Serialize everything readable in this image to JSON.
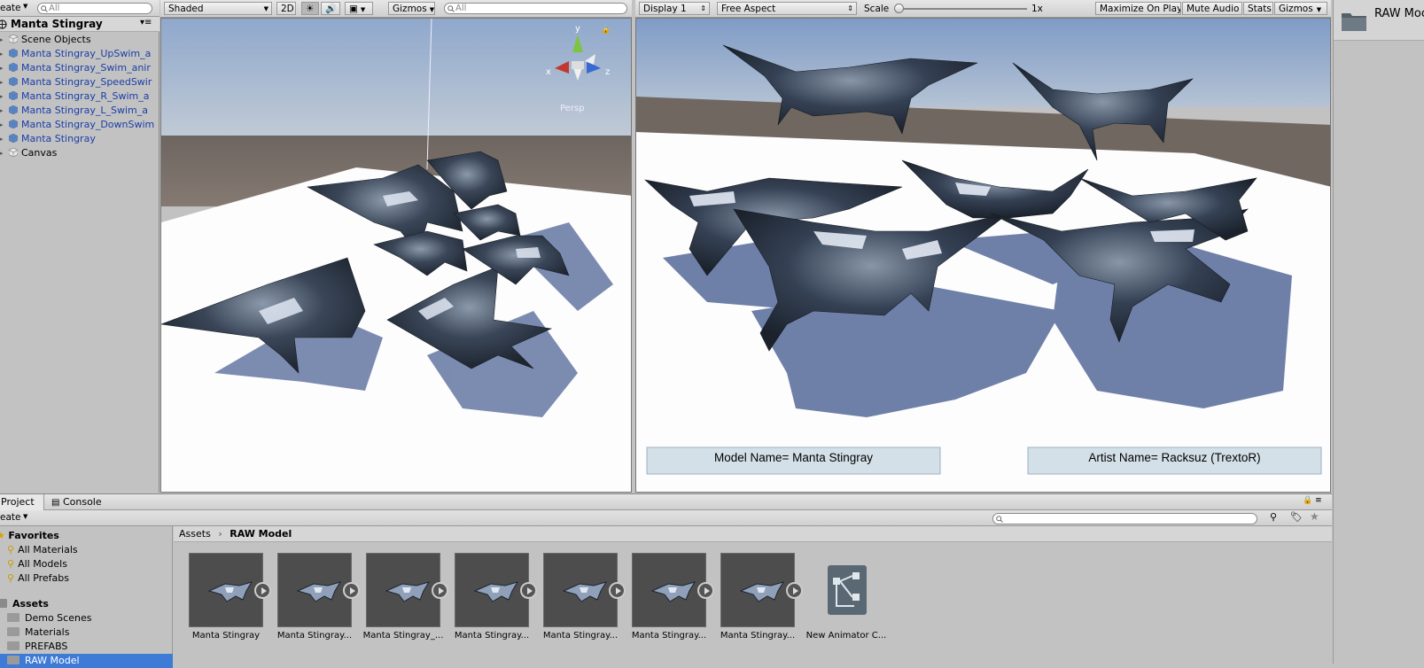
{
  "hierarchy": {
    "create_label": "eate",
    "search_placeholder": "All",
    "scene_title": "Manta Stingray",
    "items": [
      {
        "label": "Scene Objects",
        "linked": false
      },
      {
        "label": "Manta Stingray_UpSwim_a",
        "linked": true
      },
      {
        "label": "Manta Stingray_Swim_anir",
        "linked": true
      },
      {
        "label": "Manta Stingray_SpeedSwir",
        "linked": true
      },
      {
        "label": "Manta Stingray_R_Swim_a",
        "linked": true
      },
      {
        "label": "Manta Stingray_L_Swim_a",
        "linked": true
      },
      {
        "label": "Manta Stingray_DownSwim",
        "linked": true
      },
      {
        "label": "Manta Stingray",
        "linked": true
      },
      {
        "label": "Canvas",
        "linked": false
      }
    ]
  },
  "scene_view": {
    "shading_mode": "Shaded",
    "mode_2d": "2D",
    "gizmos_label": "Gizmos",
    "search_placeholder": "All",
    "gizmo": {
      "y": "y",
      "x": "x",
      "z": "z",
      "persp": "Persp"
    }
  },
  "game_view": {
    "display": "Display 1",
    "aspect": "Free Aspect",
    "scale_label": "Scale",
    "scale_value": "1x",
    "scale_fraction": 0.0,
    "maximize_on_play": "Maximize On Play",
    "mute_audio": "Mute Audio",
    "stats": "Stats",
    "gizmos": "Gizmos",
    "overlay_model": "Model Name= Manta Stingray",
    "overlay_artist": "Artist Name= Racksuz (TrextoR)"
  },
  "inspector": {
    "folder_label": "RAW Moc"
  },
  "project": {
    "tab_project": "Project",
    "tab_console": "Console",
    "create_label": "eate",
    "favorites_title": "Favorites",
    "favorites": [
      "All Materials",
      "All Models",
      "All Prefabs"
    ],
    "assets_title": "Assets",
    "asset_folders": [
      "Demo Scenes",
      "Materials",
      "PREFABS",
      "RAW Model"
    ],
    "breadcrumb": {
      "root": "Assets",
      "current": "RAW Model"
    },
    "assets": [
      {
        "label": "Manta Stingray",
        "kind": "model"
      },
      {
        "label": "Manta Stingray...",
        "kind": "model"
      },
      {
        "label": "Manta Stingray_...",
        "kind": "model"
      },
      {
        "label": "Manta Stingray...",
        "kind": "model"
      },
      {
        "label": "Manta Stingray...",
        "kind": "model"
      },
      {
        "label": "Manta Stingray...",
        "kind": "model"
      },
      {
        "label": "Manta Stingray...",
        "kind": "model"
      },
      {
        "label": "New Animator C...",
        "kind": "animator"
      }
    ]
  },
  "colors": {
    "selection": "#3e7bd6",
    "link_blue": "#1a3ea8",
    "panel_bg": "#c2c2c2"
  }
}
